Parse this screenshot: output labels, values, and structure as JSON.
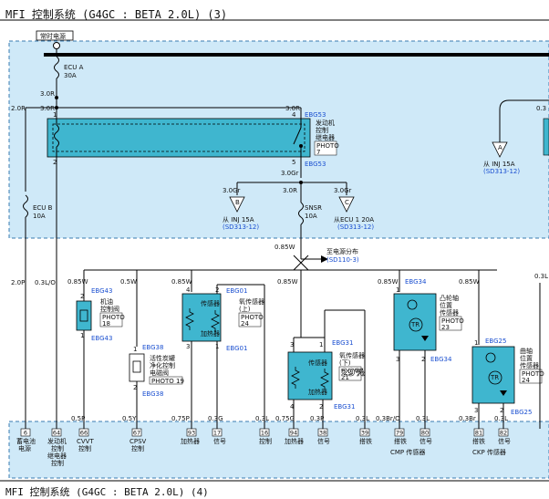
{
  "title": "MFI 控制系统 (G4GC : BETA 2.0L) (3)",
  "footer_title": "MFI 控制系统 (G4GC : BETA 2.0L) (4)",
  "colors": {
    "zone": "#cfe9f8",
    "component": "#3fb6cf",
    "wire": "#000000",
    "connector": "#1a4fd0"
  },
  "power": {
    "label": "常时电源"
  },
  "fuse_a": {
    "name": "ECU A",
    "rating": "30A"
  },
  "fuse_b": {
    "name": "ECU B",
    "rating": "10A"
  },
  "fuse_snsr": {
    "name": "SNSR",
    "rating": "10A"
  },
  "relay": {
    "name1": "发动机",
    "name2": "控制",
    "name3": "继电器",
    "photo1": "PHOTO",
    "photo2": "7",
    "conn_top": "EBG53",
    "conn_bot": "EBG53",
    "pin_tl": "1",
    "pin_tr": "4",
    "pin_bl": "2",
    "pin_br": "5"
  },
  "wires": {
    "w30r_a": "3.0R",
    "w30r_b": "3.0R",
    "w30r_c": "3.0R",
    "w20r": "2.0R",
    "w30gr": "3.0Gr",
    "w30gr_l": "3.0Gr",
    "w30gr_m": "3.0R",
    "w30gr_r": "3.0Gr",
    "w085w_top": "0.85W",
    "w20p": "2.0P",
    "w03lo": "0.3L/O",
    "w085w_1": "0.85W",
    "w05w": "0.5W",
    "w085w_2": "0.85W",
    "w085w_3": "0.85W",
    "w085w_4": "0.85W",
    "w085w_5": "0.85W",
    "w03l_r": "0.3L",
    "w30r_right": "0.3",
    "b05p": "0.5P",
    "b05y": "0.5Y",
    "b075p": "0.75P",
    "b03g": "0.3G",
    "b03l_1": "0.3L",
    "b075g": "0.75G",
    "b03p": "0.3P",
    "b03l_2": "0.3L",
    "b03bro": "0.3Br/O",
    "b03l_3": "0.3L",
    "b03br": "0.3Br",
    "b03l_4": "0.3L"
  },
  "refs": {
    "inj_left_a": "从 INJ 15A",
    "inj_left_b": "(SD313-12)",
    "inj_mid_a": "从 INJ 15A",
    "inj_mid_b": "(SD313-12)",
    "ecu_right_a": "从ECU 1 20A",
    "ecu_right_b": "(SD313-12)",
    "power_dist_a": "至电源分布",
    "power_dist_b": "(SD110-3)"
  },
  "comp_cvvt": {
    "n1": "机油",
    "n2": "控制阀",
    "photo": "PHOTO",
    "num": "18",
    "conn_t": "EBG43",
    "conn_b": "EBG43",
    "pin_t": "2",
    "pin_b": "1"
  },
  "comp_purge": {
    "n1": "活性炭罐",
    "n2": "净化控制",
    "n3": "电磁阀",
    "photo": "PHOTO 19",
    "conn_t": "EBG38",
    "conn_b": "EBG38",
    "pin_t": "1",
    "pin_b": "2"
  },
  "comp_o2up": {
    "n1": "氧传感器",
    "n2": "(上)",
    "inner1": "传感器",
    "inner2": "加热器",
    "photo": "PHOTO",
    "num": "24",
    "conn_t": "EBG01",
    "conn_b": "EBG01",
    "pin_tl": "4",
    "pin_tr": "2",
    "pin_bl": "3",
    "pin_br": "1"
  },
  "comp_o2dn": {
    "n1": "氧传感器",
    "n2": "(下)",
    "inner1": "传感器",
    "inner2": "加热器",
    "photo": "PHOTO",
    "num": "21",
    "mark": "29%",
    "conn_t": "EBG31",
    "conn_b": "EBG31",
    "pin_tl": "3",
    "pin_tr": "1",
    "pin_bl": "4",
    "pin_br": "2"
  },
  "comp_cmp": {
    "n1": "凸轮轴",
    "n2": "位置",
    "n3": "传感器",
    "photo": "PHOTO",
    "num": "23",
    "conn_t": "EBG34",
    "conn_b": "EBG34",
    "pin_tl": "1",
    "pin_bl": "3",
    "pin_br": "2",
    "tr": "TR"
  },
  "comp_ckp": {
    "n1": "曲轴",
    "n2": "位置",
    "n3": "传感器",
    "photo": "PHOTO",
    "num": "24",
    "conn_t": "EBG25",
    "conn_b": "EBG25",
    "pin_tl": "1",
    "pin_bl": "3",
    "pin_br": "2",
    "tr": "TR"
  },
  "ecu_pins": [
    "6",
    "64",
    "66",
    "67",
    "93",
    "17",
    "16",
    "94",
    "38",
    "39",
    "79",
    "80",
    "81",
    "82"
  ],
  "ecu_labels": {
    "l1a": "蓄电池",
    "l1b": "电源",
    "l2a": "发动机",
    "l2b": "控制",
    "l2c": "继电器",
    "l2d": "控制",
    "l3a": "CVVT",
    "l3b": "控制",
    "l4a": "CPSV",
    "l4b": "控制",
    "l5": "加热器",
    "l6": "信号",
    "l7": "控制",
    "l8": "加热器",
    "l9": "信号",
    "l10": "搭铁",
    "l11": "搭铁",
    "l12": "信号",
    "l13": "CMP 传感器",
    "l14": "搭铁",
    "l15": "信号",
    "l16": "CKP 传感器"
  }
}
